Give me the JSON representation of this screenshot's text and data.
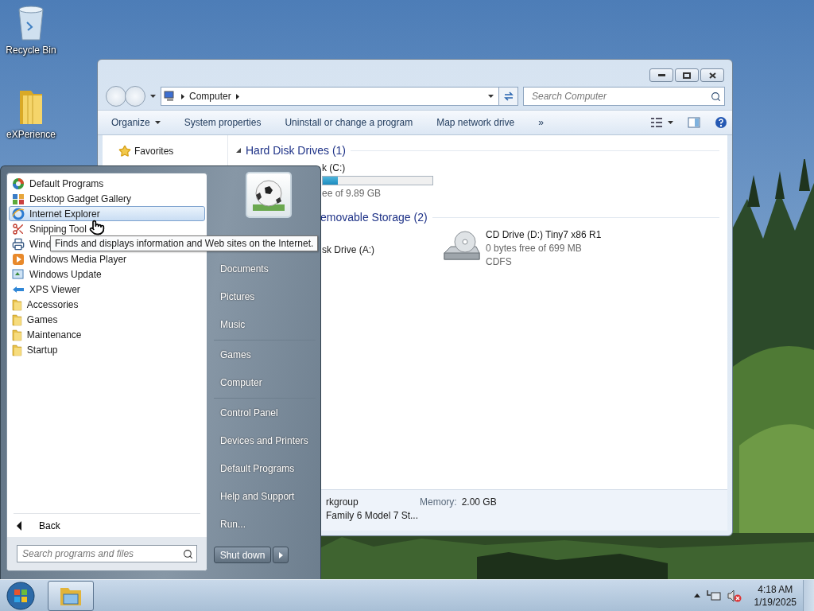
{
  "desktop": {
    "icons": [
      {
        "label": "Recycle Bin",
        "kind": "recycle"
      },
      {
        "label": "eXPerience",
        "kind": "folder"
      }
    ]
  },
  "explorer": {
    "breadcrumb": [
      "Computer"
    ],
    "search": {
      "placeholder": "Search Computer"
    },
    "toolbar": [
      {
        "label": "Organize",
        "dropdown": true
      },
      {
        "label": "System properties",
        "dropdown": false
      },
      {
        "label": "Uninstall or change a program",
        "dropdown": false
      },
      {
        "label": "Map network drive",
        "dropdown": false
      },
      {
        "label": "»",
        "dropdown": false
      }
    ],
    "nav": [
      {
        "label": "Favorites"
      }
    ],
    "groups": [
      {
        "title": "Hard Disk Drives (1)",
        "arrow": true,
        "drives": [
          {
            "kind": "hdd",
            "name": "k (C:)",
            "free": "ee of 9.89 GB",
            "level": 0.14
          }
        ]
      },
      {
        "title": "emovable Storage (2)",
        "arrow": false,
        "drives": [
          {
            "kind": "partial",
            "name": "sk Drive (A:)"
          },
          {
            "kind": "cd",
            "name": "CD Drive (D:) Tiny7 x86 R1",
            "free": "0 bytes free of 699 MB",
            "fs": "CDFS"
          }
        ]
      }
    ],
    "details": [
      [
        {
          "value": "rkgroup"
        },
        {
          "label": "Memory:",
          "value": "2.00 GB"
        }
      ],
      [
        {
          "value": "Family 6 Model 7 St..."
        }
      ]
    ]
  },
  "start_menu": {
    "programs": [
      {
        "label": "Default Programs",
        "kind": "default",
        "selected": false
      },
      {
        "label": "Desktop Gadget Gallery",
        "kind": "gadget",
        "selected": false
      },
      {
        "label": "Internet Explorer",
        "kind": "ie",
        "selected": true
      },
      {
        "label": "Snipping Tool",
        "kind": "snip",
        "selected": false
      },
      {
        "label": "Wind",
        "kind": "fax",
        "selected": false
      },
      {
        "label": "Windows Media Player",
        "kind": "wmp",
        "selected": false
      },
      {
        "label": "Windows Update",
        "kind": "update",
        "selected": false
      },
      {
        "label": "XPS Viewer",
        "kind": "xps",
        "selected": false
      },
      {
        "label": "Accessories",
        "kind": "folder",
        "selected": false
      },
      {
        "label": "Games",
        "kind": "folder",
        "selected": false
      },
      {
        "label": "Maintenance",
        "kind": "folder",
        "selected": false
      },
      {
        "label": "Startup",
        "kind": "folder",
        "selected": false
      }
    ],
    "tooltip": "Finds and displays information and Web sites on the Internet.",
    "back": "Back",
    "search": {
      "placeholder": "Search programs and files"
    },
    "places": [
      [
        "Documents",
        "Pictures",
        "Music"
      ],
      [
        "Games",
        "Computer"
      ],
      [
        "Control Panel",
        "Devices and Printers",
        "Default Programs",
        "Help and Support",
        "Run..."
      ]
    ],
    "shutdown": "Shut down"
  },
  "taskbar": {
    "buttons": [
      {
        "kind": "explorer",
        "selected": true
      }
    ],
    "time": "4:18 AM",
    "date": "1/19/2025"
  }
}
